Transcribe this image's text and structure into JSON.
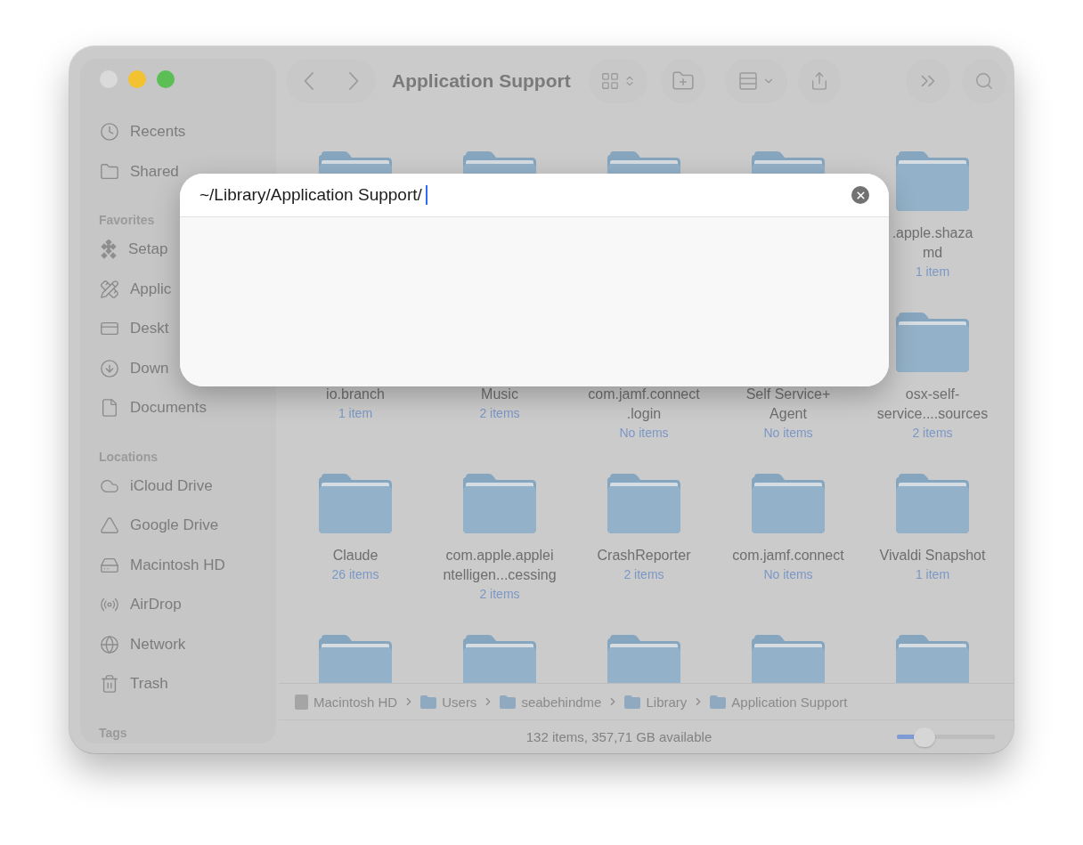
{
  "window": {
    "title": "Application Support"
  },
  "sidebar": {
    "sections": [
      {
        "items": [
          {
            "label": "Recents",
            "kind": "clock"
          },
          {
            "label": "Shared",
            "kind": "shared"
          }
        ]
      },
      {
        "header": "Favorites",
        "items": [
          {
            "label": "Setap",
            "kind": "setapp"
          },
          {
            "label": "Applic",
            "kind": "apps"
          },
          {
            "label": "Deskt",
            "kind": "desktop"
          },
          {
            "label": "Down",
            "kind": "download"
          },
          {
            "label": "Documents",
            "kind": "document"
          }
        ]
      },
      {
        "header": "Locations",
        "items": [
          {
            "label": "iCloud Drive",
            "kind": "cloud"
          },
          {
            "label": "Google Drive",
            "kind": "triangle"
          },
          {
            "label": "Macintosh HD",
            "kind": "drive"
          },
          {
            "label": "AirDrop",
            "kind": "airdrop"
          },
          {
            "label": "Network",
            "kind": "globe"
          },
          {
            "label": "Trash",
            "kind": "trash"
          }
        ]
      },
      {
        "header": "Tags"
      }
    ]
  },
  "grid": {
    "rows": [
      [
        {
          "kind": "folder"
        },
        {
          "kind": "folder"
        },
        {
          "kind": "folder"
        },
        {
          "kind": "folder"
        },
        {
          "kind": "folder",
          "name": [
            ".apple.shaza",
            "md"
          ],
          "count": "1 item"
        }
      ],
      [
        {
          "name": [
            "io.branch"
          ],
          "count": "1 item"
        },
        {
          "name": [
            "Music"
          ],
          "count": "2 items"
        },
        {
          "name": [
            "com.jamf.connect",
            ".login"
          ],
          "count": "No items"
        },
        {
          "name": [
            "Self Service+",
            "Agent"
          ],
          "count": "No items"
        },
        {
          "kind": "folder",
          "name": [
            "osx-self-",
            "service....sources"
          ],
          "count": "2 items"
        }
      ],
      [
        {
          "kind": "folder",
          "name": [
            "Claude"
          ],
          "count": "26 items"
        },
        {
          "kind": "folder",
          "name": [
            "com.apple.applei",
            "ntelligen...cessing"
          ],
          "count": "2 items"
        },
        {
          "kind": "folder",
          "name": [
            "CrashReporter"
          ],
          "count": "2 items"
        },
        {
          "kind": "folder",
          "name": [
            "com.jamf.connect"
          ],
          "count": "No items"
        },
        {
          "kind": "folder",
          "name": [
            "Vivaldi Snapshot"
          ],
          "count": "1 item"
        }
      ],
      [
        {
          "kind": "folder"
        },
        {
          "kind": "folder"
        },
        {
          "kind": "folder"
        },
        {
          "kind": "folder"
        },
        {
          "kind": "folder"
        }
      ]
    ]
  },
  "path_bar": [
    {
      "label": "Macintosh HD",
      "kind": "drive"
    },
    {
      "label": "Users",
      "kind": "folder"
    },
    {
      "label": "seabehindme",
      "kind": "folder"
    },
    {
      "label": "Library",
      "kind": "folder"
    },
    {
      "label": "Application Support",
      "kind": "folder"
    }
  ],
  "status_bar": {
    "text": "132 items, 357,71 GB available",
    "zoom": {
      "level": 0.28
    }
  },
  "go_to_dialog": {
    "value": "~/Library/Application Support/"
  }
}
